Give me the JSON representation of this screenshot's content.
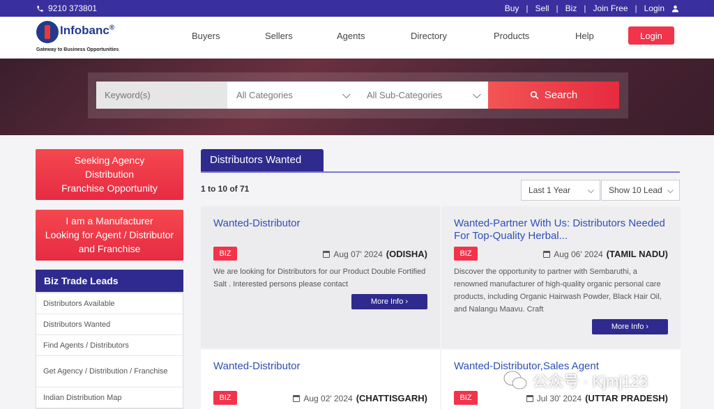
{
  "topbar": {
    "phone": "9210 373801",
    "links": [
      "Buy",
      "Sell",
      "Biz",
      "Join Free",
      "Login"
    ]
  },
  "header": {
    "logo_brand": "Infobanc",
    "logo_reg": "®",
    "logo_tagline": "Gateway to Business Opportunities",
    "nav": [
      "Buyers",
      "Sellers",
      "Agents",
      "Directory",
      "Products",
      "Help"
    ],
    "login_label": "Login"
  },
  "search": {
    "keyword_placeholder": "Keyword(s)",
    "category": "All Categories",
    "subcategory": "All Sub-Categories",
    "button_label": "Search"
  },
  "sidebar": {
    "cta1": [
      "Seeking Agency",
      "Distribution",
      "Franchise Opportunity"
    ],
    "cta2": [
      "I am a Manufacturer",
      "Looking for Agent / Distributor",
      "and Franchise"
    ],
    "section_title": "Biz Trade Leads",
    "items": [
      "Distributors Available",
      "Distributors Wanted",
      "Find Agents / Distributors",
      "Get Agency / Distribution / Franchise",
      "Indian Distribution Map"
    ]
  },
  "main": {
    "tab_label": "Distributors Wanted",
    "count": "1 to 10 of 71",
    "filter_period": "Last 1 Year",
    "filter_show": "Show 10 Lead",
    "leads": [
      {
        "title": "Wanted-Distributor",
        "badge": "BIZ",
        "date": "Aug 07' 2024",
        "location": "(ODISHA)",
        "desc": "We are looking for Distributors for our Product Double Fortified Salt . Interested persons please contact",
        "more": "More Info"
      },
      {
        "title": "Wanted-Partner With Us: Distributors Needed For Top-Quality Herbal...",
        "badge": "BIZ",
        "date": "Aug 06' 2024",
        "location": "(TAMIL NADU)",
        "desc": "Discover the opportunity to partner with Sembaruthi, a renowned manufacturer of high-quality organic personal care products, including Organic Hairwash Powder, Black Hair Oil, and Nalangu Maavu. Craft",
        "more": "More Info"
      },
      {
        "title": "Wanted-Distributor",
        "badge": "BIZ",
        "date": "Aug 02' 2024",
        "location": "(CHATTISGARH)"
      },
      {
        "title": "Wanted-Distributor,Sales Agent",
        "badge": "BIZ",
        "date": "Jul 30' 2024",
        "location": "(UTTAR PRADESH)"
      }
    ]
  },
  "watermark": "公众号 · Kjmj123"
}
